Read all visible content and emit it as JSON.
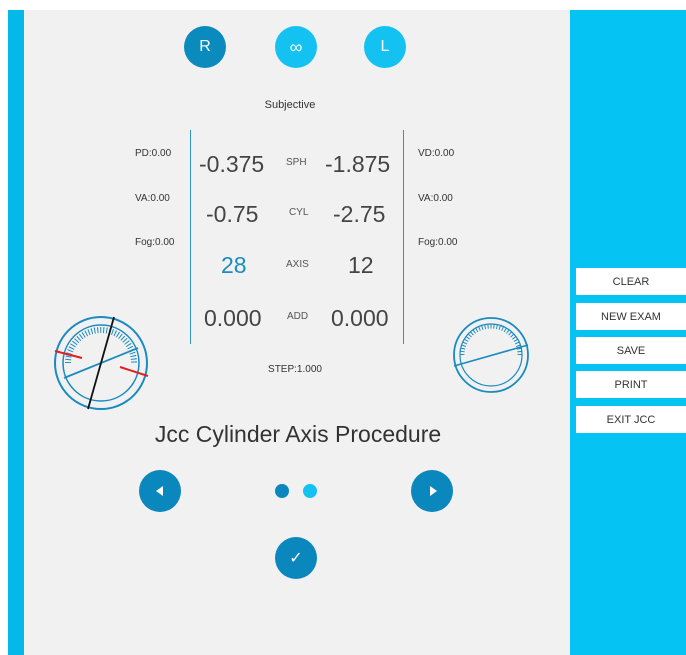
{
  "eye_select": {
    "right": "R",
    "both": "∞",
    "left": "L",
    "selected": "R"
  },
  "mode": "Subjective",
  "left_info": {
    "pd": "PD:0.00",
    "va": "VA:0.00",
    "fog": "Fog:0.00"
  },
  "right_info": {
    "vd": "VD:0.00",
    "va": "VA:0.00",
    "fog": "Fog:0.00"
  },
  "rows": [
    {
      "left": "-0.375",
      "label": "SPH",
      "right": "-1.875"
    },
    {
      "left": "-0.75",
      "label": "CYL",
      "right": "-2.75"
    },
    {
      "left": "28",
      "label": "AXIS",
      "right": "12"
    },
    {
      "left": "0.000",
      "label": "ADD",
      "right": "0.000"
    }
  ],
  "step": "STEP:1.000",
  "procedure_title": "Jcc Cylinder Axis Procedure",
  "pager": {
    "pages": 2,
    "current": 1
  },
  "side_buttons": {
    "clear": "CLEAR",
    "new_exam": "NEW EXAM",
    "save": "SAVE",
    "print": "PRINT",
    "exit_jcc": "EXIT JCC"
  },
  "colors": {
    "primary": "#0a87bd",
    "accent": "#14c2f2",
    "panel": "#05c4f3",
    "background": "#f1f1f1",
    "jcc_marker": "#e02020"
  },
  "icons": {
    "prev": "arrow-left-icon",
    "next": "arrow-right-icon",
    "confirm": "check-icon"
  }
}
